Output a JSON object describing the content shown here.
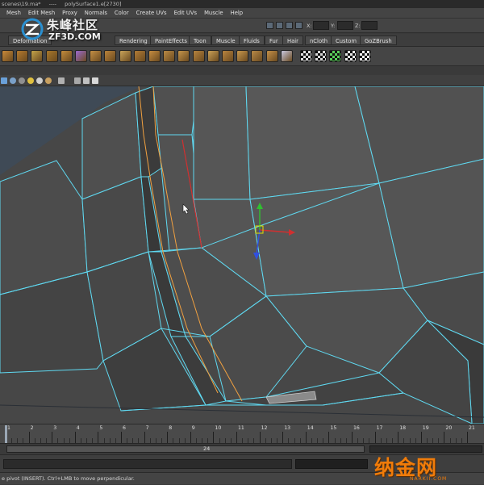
{
  "window": {
    "title_left": "scenes\\19.ma*",
    "title_sep": "----",
    "title_right": "polySurface1.e[2730]"
  },
  "menus": [
    "Mesh",
    "Edit Mesh",
    "Proxy",
    "Normals",
    "Color",
    "Create UVs",
    "Edit UVs",
    "Muscle",
    "Help"
  ],
  "status_line": {
    "x_label": "X:",
    "y_label": "Y:",
    "z_label": "Z:"
  },
  "shelf_tabs": [
    "Deformation",
    "Rendering",
    "PaintEffects",
    "Toon",
    "Muscle",
    "Fluids",
    "Fur",
    "Hair",
    "nCloth",
    "Custom",
    "GoZBrush"
  ],
  "shelf_icons": [
    {
      "name": "shelf-tool-icon",
      "color": "#c98a3a"
    },
    {
      "name": "shelf-tool-icon",
      "color": "#b57a2e"
    },
    {
      "name": "shelf-tool-icon",
      "color": "#c4a44a"
    },
    {
      "name": "shelf-tool-icon",
      "color": "#a8782b"
    },
    {
      "name": "shelf-tool-icon",
      "color": "#c48c3c"
    },
    {
      "name": "cube-icon",
      "color": "#9c6ad0"
    },
    {
      "name": "shelf-tool-icon",
      "color": "#c59045"
    },
    {
      "name": "shelf-tool-icon",
      "color": "#b9833b"
    },
    {
      "name": "shelf-tool-icon",
      "color": "#c9a35a"
    },
    {
      "name": "shelf-tool-icon",
      "color": "#b27c36"
    },
    {
      "name": "shelf-tool-icon",
      "color": "#c68d40"
    },
    {
      "name": "shelf-tool-icon",
      "color": "#ba8a44"
    },
    {
      "name": "shelf-tool-icon",
      "color": "#c5954b"
    },
    {
      "name": "shelf-tool-icon",
      "color": "#b7843e"
    },
    {
      "name": "shelf-tool-icon",
      "color": "#caa056"
    },
    {
      "name": "shelf-tool-icon",
      "color": "#b9853f"
    },
    {
      "name": "shelf-tool-icon",
      "color": "#c8984d"
    },
    {
      "name": "shelf-tool-icon",
      "color": "#b88a47"
    },
    {
      "name": "shelf-tool-icon",
      "color": "#c49048"
    },
    {
      "name": "cone-icon",
      "color": "#c8c8e0"
    },
    {
      "name": "checker-icon",
      "color": "#e0e0e0"
    },
    {
      "name": "checker-icon",
      "color": "#d8d8d8"
    },
    {
      "name": "checker-icon",
      "color": "#5ad05a"
    },
    {
      "name": "checker-icon",
      "color": "#e8e8e8"
    },
    {
      "name": "checker-icon",
      "color": "#f0f0f0"
    }
  ],
  "timeline": {
    "frames": [
      1,
      2,
      3,
      4,
      5,
      6,
      7,
      8,
      9,
      10,
      11,
      12,
      13,
      14,
      15,
      16,
      17,
      18,
      19,
      20,
      21
    ],
    "current_frame": 1
  },
  "range": {
    "value": "24"
  },
  "help_line": {
    "text": "e pivot (INSERT).  Ctrl+LMB to move perpendicular."
  },
  "watermarks": {
    "top_left_cn": "朱峰社区",
    "top_left_en": "ZF3D.COM",
    "bottom_right_cn": "纳金网",
    "bottom_right_en": "NARKII.COM"
  },
  "colors": {
    "wire": "#5fd8f0",
    "seam": "#f0a040",
    "edge_selected": "#d03030",
    "axis_x": "#d03030",
    "axis_y": "#30c030",
    "axis_z": "#3050e0"
  }
}
